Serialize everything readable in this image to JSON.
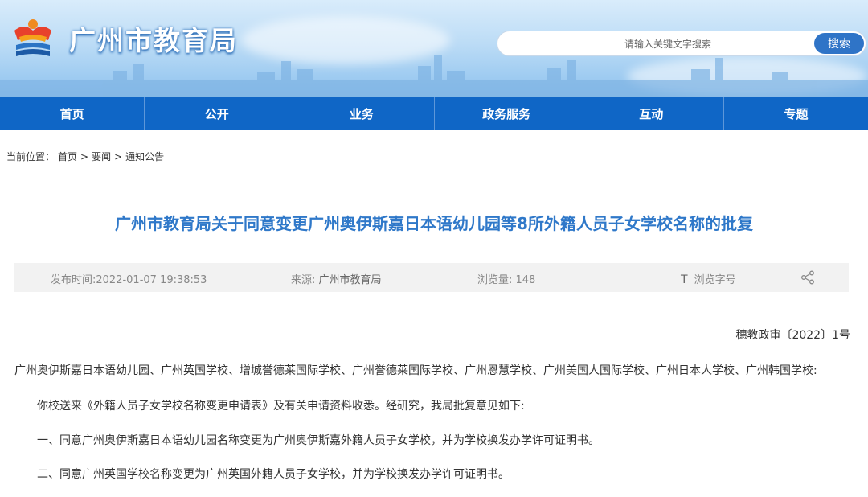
{
  "header": {
    "site_title": "广州市教育局",
    "search_placeholder": "请输入关键文字搜索",
    "search_button": "搜索"
  },
  "nav": {
    "items": [
      {
        "label": "首页"
      },
      {
        "label": "公开"
      },
      {
        "label": "业务"
      },
      {
        "label": "政务服务"
      },
      {
        "label": "互动"
      },
      {
        "label": "专题"
      }
    ]
  },
  "breadcrumb": {
    "prefix": "当前位置：",
    "items": [
      "首页",
      "要闻",
      "通知公告"
    ],
    "separator": ">"
  },
  "article": {
    "title": "广州市教育局关于同意变更广州奥伊斯嘉日本语幼儿园等8所外籍人员子女学校名称的批复",
    "publish_time": "发布时间:2022-01-07 19:38:53",
    "source_label": "来源: ",
    "source_value": "广州市教育局",
    "views": "浏览量:  148",
    "font_t": "T",
    "font_label": "浏览字号",
    "doc_number": "穗教政审〔2022〕1号",
    "recipients": "广州奥伊斯嘉日本语幼儿园、广州英国学校、增城誉德莱国际学校、广州誉德莱国际学校、广州恩慧学校、广州美国人国际学校、广州日本人学校、广州韩国学校:",
    "body": [
      "你校送来《外籍人员子女学校名称变更申请表》及有关申请资料收悉。经研究，我局批复意见如下:",
      "一、同意广州奥伊斯嘉日本语幼儿园名称变更为广州奥伊斯嘉外籍人员子女学校，并为学校换发办学许可证明书。",
      "二、同意广州英国学校名称变更为广州英国外籍人员子女学校，并为学校换发办学许可证明书。"
    ]
  },
  "colors": {
    "nav_bg": "#0f66c6",
    "title_blue": "#2f78c9",
    "search_button_bg": "#2f74c7"
  }
}
